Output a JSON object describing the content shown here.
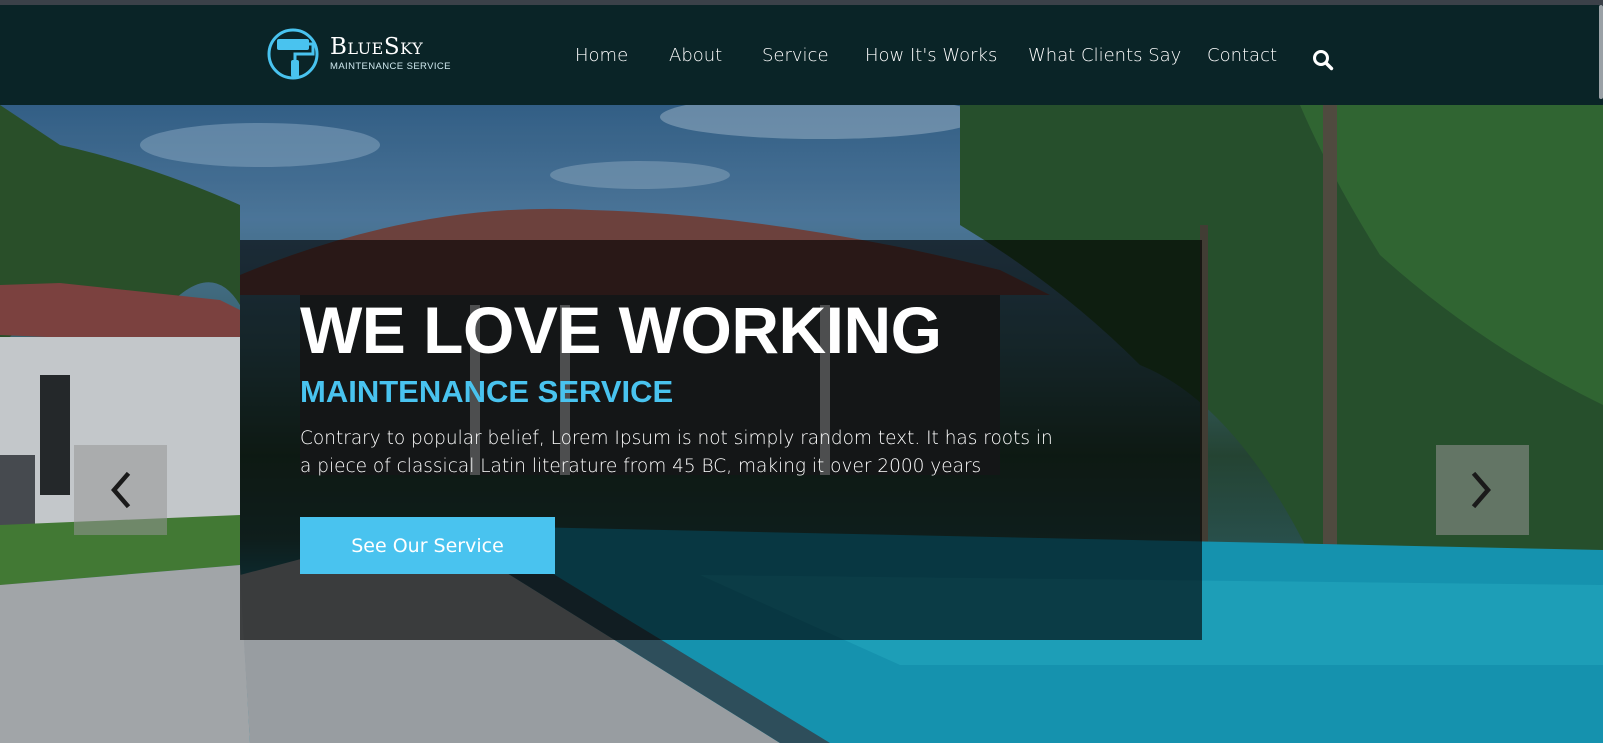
{
  "brand": {
    "name": "BlueSky",
    "tagline": "MAINTENANCE SERVICE",
    "accent_color": "#49c3ef",
    "logo_icon": "paint-roller-icon"
  },
  "nav": {
    "items": [
      {
        "label": "Home"
      },
      {
        "label": "About"
      },
      {
        "label": "Service"
      },
      {
        "label": "How It's Works"
      },
      {
        "label": "What Clients Say"
      },
      {
        "label": "Contact"
      }
    ],
    "search_icon": "search-icon"
  },
  "hero": {
    "headline": "WE LOVE WORKING",
    "subheadline": "MAINTENANCE SERVICE",
    "description": "Contrary to popular belief, Lorem Ipsum is not simply random text. It has roots in a piece of classical Latin literature from 45 BC, making it over 2000 years",
    "cta_label": "See Our Service",
    "prev_icon": "chevron-left-icon",
    "next_icon": "chevron-right-icon",
    "background": "villa-pool-palm-trees-photo"
  }
}
